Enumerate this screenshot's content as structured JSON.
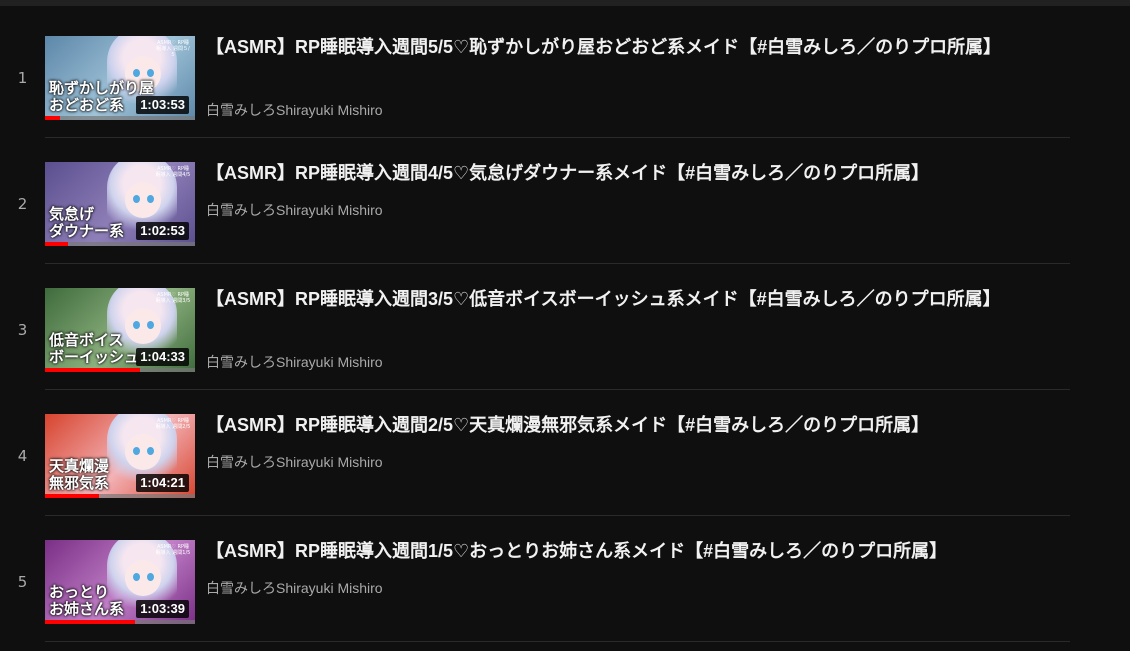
{
  "playlist": {
    "items": [
      {
        "index": "1",
        "title": "【ASMR】RP睡眠導入週間5/5♡恥ずかしがり屋おどおど系メイド【#白雪みしろ／のりプロ所属】",
        "channel": "白雪みしろShirayuki Mishiro",
        "duration": "1:03:53",
        "thumb_text": "恥ずかしがり屋\nおどおど系",
        "thumb_caption": "ASMR♡\nRP睡眠導入\n週間５/５",
        "watched_progress": 0.1,
        "thumb_colors": [
          "#5d87a9",
          "#9fc3d8"
        ]
      },
      {
        "index": "2",
        "title": "【ASMR】RP睡眠導入週間4/5♡気怠げダウナー系メイド【#白雪みしろ／のりプロ所属】",
        "channel": "白雪みしろShirayuki Mishiro",
        "duration": "1:02:53",
        "thumb_text": "気怠げ\nダウナー系",
        "thumb_caption": "ASMR♡\nRP睡眠導入\n週間4/5",
        "watched_progress": 0.15,
        "thumb_colors": [
          "#5b4f8f",
          "#8f7fb8"
        ]
      },
      {
        "index": "3",
        "title": "【ASMR】RP睡眠導入週間3/5♡低音ボイスボーイッシュ系メイド【#白雪みしろ／のりプロ所属】",
        "channel": "白雪みしろShirayuki Mishiro",
        "duration": "1:04:33",
        "thumb_text": "低音ボイス\nボーイッシュ",
        "thumb_caption": "ASMR♡\nRP睡眠導入\n週間3/5",
        "watched_progress": 0.63,
        "thumb_colors": [
          "#3f6b3c",
          "#8cb07e"
        ]
      },
      {
        "index": "4",
        "title": "【ASMR】RP睡眠導入週間2/5♡天真爛漫無邪気系メイド【#白雪みしろ／のりプロ所属】",
        "channel": "白雪みしろShirayuki Mishiro",
        "duration": "1:04:21",
        "thumb_text": "天真爛漫\n無邪気系",
        "thumb_caption": "ASMR♡\nRP睡眠導入\n週間2/5",
        "watched_progress": 0.36,
        "thumb_colors": [
          "#d7442e",
          "#f3b2b6"
        ]
      },
      {
        "index": "5",
        "title": "【ASMR】RP睡眠導入週間1/5♡おっとりお姉さん系メイド【#白雪みしろ／のりプロ所属】",
        "channel": "白雪みしろShirayuki Mishiro",
        "duration": "1:03:39",
        "thumb_text": "おっとり\nお姉さん系",
        "thumb_caption": "ASMR♡\nRP睡眠導入\n週間1/5",
        "watched_progress": 0.6,
        "thumb_colors": [
          "#7a2f86",
          "#c07fc6"
        ]
      }
    ]
  }
}
